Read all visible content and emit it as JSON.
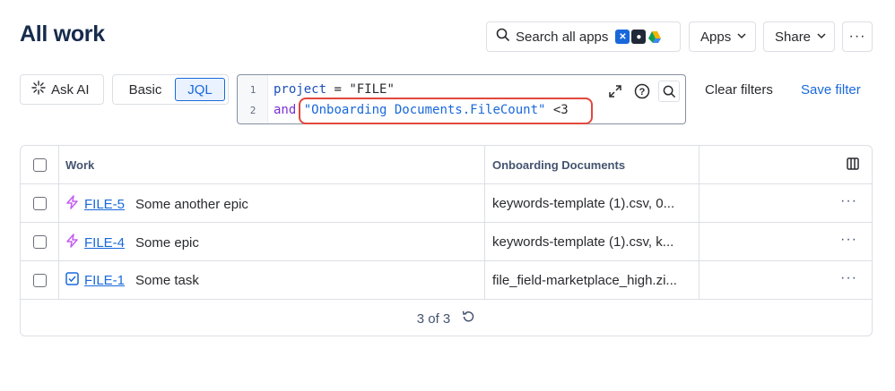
{
  "page": {
    "title": "All work"
  },
  "header": {
    "search_label": "Search all apps",
    "apps_label": "Apps",
    "share_label": "Share",
    "more_label": "···"
  },
  "toolbar": {
    "ask_ai_label": "Ask AI",
    "basic_label": "Basic",
    "jql_label": "JQL",
    "clear_filters_label": "Clear filters",
    "save_filter_label": "Save filter"
  },
  "editor": {
    "line_numbers": [
      "1",
      "2"
    ],
    "line1": {
      "field": "project",
      "op": " = ",
      "value": "\"FILE\""
    },
    "line2": {
      "keyword": "and",
      "field": " \"Onboarding Documents.FileCount\"",
      "op": " <3"
    }
  },
  "table": {
    "headers": {
      "work": "Work",
      "docs": "Onboarding Documents"
    },
    "rows": [
      {
        "type": "epic",
        "key": "FILE-5",
        "summary": "Some another epic",
        "docs": "keywords-template (1).csv, 0..."
      },
      {
        "type": "epic",
        "key": "FILE-4",
        "summary": "Some epic",
        "docs": "keywords-template (1).csv, k..."
      },
      {
        "type": "task",
        "key": "FILE-1",
        "summary": "Some task",
        "docs": "file_field-marketplace_high.zi..."
      }
    ],
    "row_more_label": "···",
    "footer_count": "3 of 3"
  },
  "colors": {
    "accent": "#1868db",
    "epic": "#c55cf2",
    "task": "#1868db",
    "highlight": "#e2483d"
  }
}
